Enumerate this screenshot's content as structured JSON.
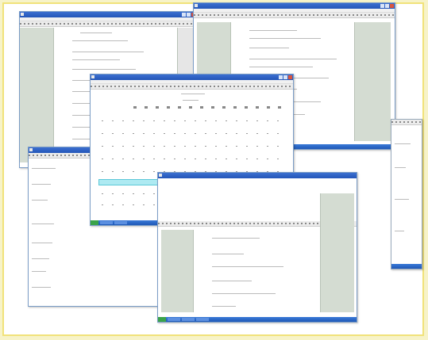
{
  "windows": [],
  "watermark": ""
}
